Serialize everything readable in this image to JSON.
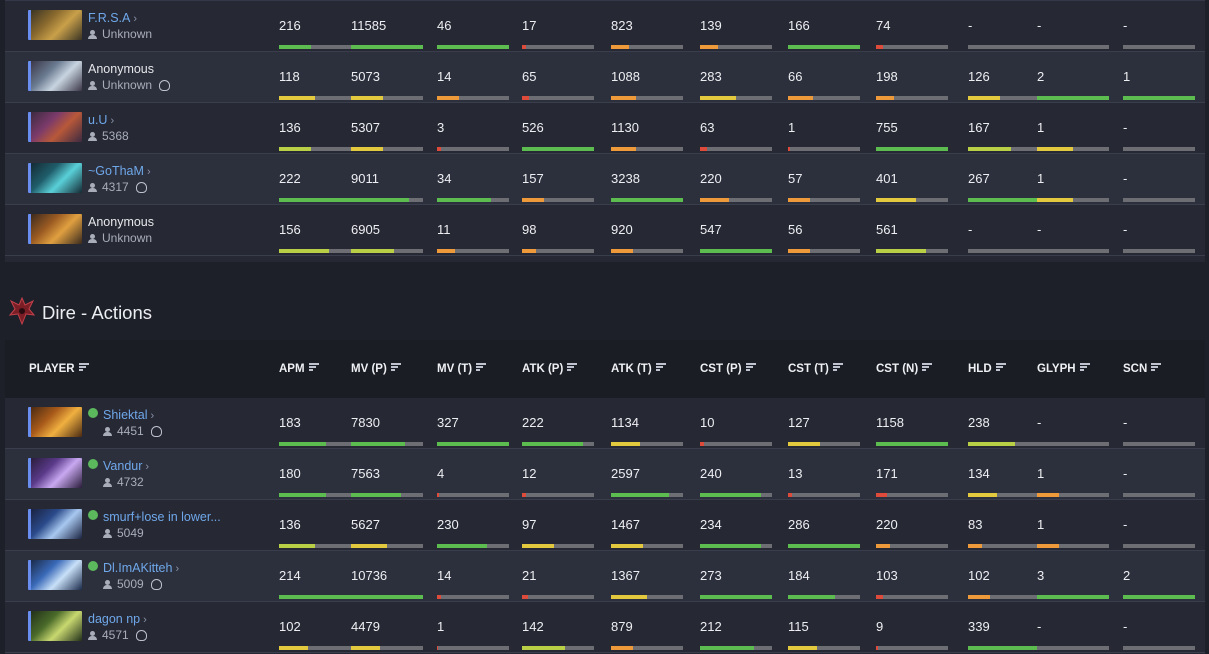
{
  "colors": {
    "green": "#5cbc4f",
    "yellowgreen": "#b9cf46",
    "yellow": "#e2c93d",
    "orange": "#ef9a3a",
    "red": "#de4b3b",
    "track": "#6d6e73"
  },
  "radiant": {
    "rows": [
      {
        "name": "F.R.S.A",
        "chevron": "›",
        "link": true,
        "sub": "Unknown",
        "rank_icon": false,
        "online": false,
        "portrait": [
          "#8a6a2e",
          "#c9a04a",
          "#3a3424"
        ],
        "cells": [
          {
            "v": "216",
            "f": 0.45,
            "c": "green"
          },
          {
            "v": "11585",
            "f": 1,
            "c": "green"
          },
          {
            "v": "46",
            "f": 1,
            "c": "green"
          },
          {
            "v": "17",
            "f": 0.05,
            "c": "red"
          },
          {
            "v": "823",
            "f": 0.25,
            "c": "orange"
          },
          {
            "v": "139",
            "f": 0.25,
            "c": "orange"
          },
          {
            "v": "166",
            "f": 1,
            "c": "green"
          },
          {
            "v": "74",
            "f": 0.1,
            "c": "red"
          },
          {
            "v": "-",
            "f": 0,
            "c": "track"
          },
          {
            "v": "-",
            "f": 0,
            "c": "track"
          },
          {
            "v": "-",
            "f": 0,
            "c": "track"
          }
        ]
      },
      {
        "name": "Anonymous",
        "chevron": "",
        "link": false,
        "sub": "Unknown",
        "rank_icon": true,
        "online": false,
        "portrait": [
          "#6a7a90",
          "#c8d4e0",
          "#3b3648"
        ],
        "cells": [
          {
            "v": "118",
            "f": 0.5,
            "c": "yellow"
          },
          {
            "v": "5073",
            "f": 0.45,
            "c": "yellow"
          },
          {
            "v": "14",
            "f": 0.3,
            "c": "orange"
          },
          {
            "v": "65",
            "f": 0.1,
            "c": "red"
          },
          {
            "v": "1088",
            "f": 0.35,
            "c": "orange"
          },
          {
            "v": "283",
            "f": 0.5,
            "c": "yellow"
          },
          {
            "v": "66",
            "f": 0.35,
            "c": "orange"
          },
          {
            "v": "198",
            "f": 0.25,
            "c": "orange"
          },
          {
            "v": "126",
            "f": 0.45,
            "c": "yellow"
          },
          {
            "v": "2",
            "f": 1,
            "c": "green"
          },
          {
            "v": "1",
            "f": 1,
            "c": "green"
          }
        ]
      },
      {
        "name": "u.U",
        "chevron": "›",
        "link": true,
        "sub": "5368",
        "rank_icon": false,
        "online": false,
        "portrait": [
          "#7a3a6a",
          "#b8583a",
          "#3c2a40"
        ],
        "cells": [
          {
            "v": "136",
            "f": 0.45,
            "c": "yellowgreen"
          },
          {
            "v": "5307",
            "f": 0.45,
            "c": "yellow"
          },
          {
            "v": "3",
            "f": 0.05,
            "c": "red"
          },
          {
            "v": "526",
            "f": 1,
            "c": "green"
          },
          {
            "v": "1130",
            "f": 0.35,
            "c": "orange"
          },
          {
            "v": "63",
            "f": 0.1,
            "c": "red"
          },
          {
            "v": "1",
            "f": 0.03,
            "c": "red"
          },
          {
            "v": "755",
            "f": 1,
            "c": "green"
          },
          {
            "v": "167",
            "f": 0.6,
            "c": "yellowgreen"
          },
          {
            "v": "1",
            "f": 0.5,
            "c": "yellow"
          },
          {
            "v": "-",
            "f": 0,
            "c": "track"
          }
        ]
      },
      {
        "name": "~GoThaM",
        "chevron": "›",
        "link": true,
        "sub": "4317",
        "rank_icon": true,
        "online": false,
        "portrait": [
          "#1f5d6a",
          "#5ad0d8",
          "#142a34"
        ],
        "cells": [
          {
            "v": "222",
            "f": 1,
            "c": "green"
          },
          {
            "v": "9011",
            "f": 0.8,
            "c": "green"
          },
          {
            "v": "34",
            "f": 0.75,
            "c": "green"
          },
          {
            "v": "157",
            "f": 0.3,
            "c": "orange"
          },
          {
            "v": "3238",
            "f": 1,
            "c": "green"
          },
          {
            "v": "220",
            "f": 0.4,
            "c": "orange"
          },
          {
            "v": "57",
            "f": 0.3,
            "c": "orange"
          },
          {
            "v": "401",
            "f": 0.55,
            "c": "yellow"
          },
          {
            "v": "267",
            "f": 1,
            "c": "green"
          },
          {
            "v": "1",
            "f": 0.5,
            "c": "yellow"
          },
          {
            "v": "-",
            "f": 0,
            "c": "track"
          }
        ]
      },
      {
        "name": "Anonymous",
        "chevron": "",
        "link": false,
        "sub": "Unknown",
        "rank_icon": false,
        "online": false,
        "portrait": [
          "#9a5a22",
          "#e0a040",
          "#3a2a1e"
        ],
        "cells": [
          {
            "v": "156",
            "f": 0.7,
            "c": "yellowgreen"
          },
          {
            "v": "6905",
            "f": 0.6,
            "c": "yellowgreen"
          },
          {
            "v": "11",
            "f": 0.25,
            "c": "orange"
          },
          {
            "v": "98",
            "f": 0.2,
            "c": "orange"
          },
          {
            "v": "920",
            "f": 0.3,
            "c": "orange"
          },
          {
            "v": "547",
            "f": 1,
            "c": "green"
          },
          {
            "v": "56",
            "f": 0.3,
            "c": "orange"
          },
          {
            "v": "561",
            "f": 0.7,
            "c": "yellowgreen"
          },
          {
            "v": "-",
            "f": 0,
            "c": "track"
          },
          {
            "v": "-",
            "f": 0,
            "c": "track"
          },
          {
            "v": "-",
            "f": 0,
            "c": "track"
          }
        ]
      }
    ]
  },
  "dire": {
    "title": "Dire - Actions",
    "headers": [
      "PLAYER",
      "APM",
      "MV (P)",
      "MV (T)",
      "ATK (P)",
      "ATK (T)",
      "CST (P)",
      "CST (T)",
      "CST (N)",
      "HLD",
      "GLYPH",
      "SCN"
    ],
    "rows": [
      {
        "name": "Shiektal",
        "chevron": "›",
        "link": true,
        "sub": "4451",
        "rank_icon": true,
        "online": true,
        "portrait": [
          "#a85a1a",
          "#f0b040",
          "#4a2a12"
        ],
        "cells": [
          {
            "v": "183",
            "f": 0.65,
            "c": "green"
          },
          {
            "v": "7830",
            "f": 0.75,
            "c": "green"
          },
          {
            "v": "327",
            "f": 1,
            "c": "green"
          },
          {
            "v": "222",
            "f": 0.85,
            "c": "green"
          },
          {
            "v": "1134",
            "f": 0.4,
            "c": "yellow"
          },
          {
            "v": "10",
            "f": 0.05,
            "c": "red"
          },
          {
            "v": "127",
            "f": 0.45,
            "c": "yellow"
          },
          {
            "v": "1158",
            "f": 1,
            "c": "green"
          },
          {
            "v": "238",
            "f": 0.65,
            "c": "yellowgreen"
          },
          {
            "v": "-",
            "f": 0,
            "c": "track"
          },
          {
            "v": "-",
            "f": 0,
            "c": "track"
          }
        ]
      },
      {
        "name": "Vandur",
        "chevron": "›",
        "link": true,
        "sub": "4732",
        "rank_icon": false,
        "online": true,
        "portrait": [
          "#5a3a8a",
          "#c8a8f0",
          "#2a1c3a"
        ],
        "cells": [
          {
            "v": "180",
            "f": 0.65,
            "c": "green"
          },
          {
            "v": "7563",
            "f": 0.7,
            "c": "green"
          },
          {
            "v": "4",
            "f": 0.03,
            "c": "red"
          },
          {
            "v": "12",
            "f": 0.05,
            "c": "red"
          },
          {
            "v": "2597",
            "f": 0.8,
            "c": "green"
          },
          {
            "v": "240",
            "f": 0.85,
            "c": "green"
          },
          {
            "v": "13",
            "f": 0.05,
            "c": "red"
          },
          {
            "v": "171",
            "f": 0.15,
            "c": "red"
          },
          {
            "v": "134",
            "f": 0.4,
            "c": "yellow"
          },
          {
            "v": "1",
            "f": 0.3,
            "c": "orange"
          },
          {
            "v": "-",
            "f": 0,
            "c": "track"
          }
        ]
      },
      {
        "name": "smurf+lose in lower...",
        "chevron": "",
        "link": true,
        "sub": "5049",
        "rank_icon": false,
        "online": true,
        "portrait": [
          "#2a4a8a",
          "#a8c8f0",
          "#1a2240"
        ],
        "cells": [
          {
            "v": "136",
            "f": 0.5,
            "c": "yellowgreen"
          },
          {
            "v": "5627",
            "f": 0.5,
            "c": "yellow"
          },
          {
            "v": "230",
            "f": 0.7,
            "c": "green"
          },
          {
            "v": "97",
            "f": 0.45,
            "c": "yellow"
          },
          {
            "v": "1467",
            "f": 0.45,
            "c": "yellow"
          },
          {
            "v": "234",
            "f": 0.85,
            "c": "green"
          },
          {
            "v": "286",
            "f": 1,
            "c": "green"
          },
          {
            "v": "220",
            "f": 0.2,
            "c": "orange"
          },
          {
            "v": "83",
            "f": 0.2,
            "c": "orange"
          },
          {
            "v": "1",
            "f": 0.3,
            "c": "orange"
          },
          {
            "v": "-",
            "f": 0,
            "c": "track"
          }
        ]
      },
      {
        "name": "Dl.ImAKitteh",
        "chevron": "›",
        "link": true,
        "sub": "5009",
        "rank_icon": true,
        "online": true,
        "portrait": [
          "#3a6ab8",
          "#c8e0f8",
          "#1a2a4a"
        ],
        "cells": [
          {
            "v": "214",
            "f": 1,
            "c": "green"
          },
          {
            "v": "10736",
            "f": 1,
            "c": "green"
          },
          {
            "v": "14",
            "f": 0.05,
            "c": "red"
          },
          {
            "v": "21",
            "f": 0.08,
            "c": "red"
          },
          {
            "v": "1367",
            "f": 0.5,
            "c": "yellow"
          },
          {
            "v": "273",
            "f": 1,
            "c": "green"
          },
          {
            "v": "184",
            "f": 0.65,
            "c": "green"
          },
          {
            "v": "103",
            "f": 0.1,
            "c": "red"
          },
          {
            "v": "102",
            "f": 0.3,
            "c": "orange"
          },
          {
            "v": "3",
            "f": 1,
            "c": "green"
          },
          {
            "v": "2",
            "f": 1,
            "c": "green"
          }
        ]
      },
      {
        "name": "dagon np",
        "chevron": "›",
        "link": true,
        "sub": "4571",
        "rank_icon": true,
        "online": false,
        "portrait": [
          "#4a6a2a",
          "#c8d870",
          "#22301a"
        ],
        "cells": [
          {
            "v": "102",
            "f": 0.4,
            "c": "yellow"
          },
          {
            "v": "4479",
            "f": 0.4,
            "c": "yellow"
          },
          {
            "v": "1",
            "f": 0.02,
            "c": "red"
          },
          {
            "v": "142",
            "f": 0.6,
            "c": "yellowgreen"
          },
          {
            "v": "879",
            "f": 0.3,
            "c": "orange"
          },
          {
            "v": "212",
            "f": 0.75,
            "c": "green"
          },
          {
            "v": "115",
            "f": 0.4,
            "c": "yellow"
          },
          {
            "v": "9",
            "f": 0.03,
            "c": "red"
          },
          {
            "v": "339",
            "f": 1,
            "c": "green"
          },
          {
            "v": "-",
            "f": 0,
            "c": "track"
          },
          {
            "v": "-",
            "f": 0,
            "c": "track"
          }
        ]
      }
    ]
  }
}
